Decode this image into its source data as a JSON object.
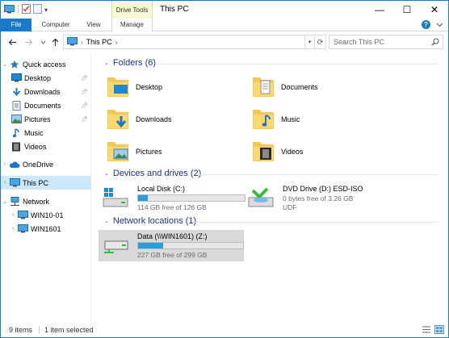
{
  "window": {
    "title": "This PC",
    "context_tab": "Drive Tools",
    "controls": {
      "minimize": "—",
      "maximize": "☐",
      "close": "✕"
    }
  },
  "ribbon": {
    "tabs": [
      "File",
      "Computer",
      "View",
      "Manage"
    ]
  },
  "address": {
    "path": [
      "This PC"
    ],
    "search_placeholder": "Search This PC"
  },
  "nav": {
    "quick_access": "Quick access",
    "quick_items": [
      "Desktop",
      "Downloads",
      "Documents",
      "Pictures",
      "Music",
      "Videos"
    ],
    "pinned": [
      true,
      true,
      true,
      true,
      false,
      false
    ],
    "onedrive": "OneDrive",
    "this_pc": "This PC",
    "network": "Network",
    "network_items": [
      "WIN10-01",
      "WIN1601"
    ]
  },
  "groups": {
    "folders": "Folders (6)",
    "devices": "Devices and drives (2)",
    "network": "Network locations (1)"
  },
  "folders": [
    "Desktop",
    "Documents",
    "Downloads",
    "Music",
    "Pictures",
    "Videos"
  ],
  "drives": [
    {
      "name": "Local Disk (C:)",
      "free": "114 GB free of 126 GB",
      "used_fraction": 0.09
    },
    {
      "name": "DVD Drive (D:) ESD-ISO",
      "free": "0 bytes free of 3.26 GB",
      "fs": "UDF"
    }
  ],
  "network_locations": [
    {
      "name": "Data (\\\\WIN1601) (Z:)",
      "free": "227 GB free of 299 GB",
      "used_fraction": 0.24
    }
  ],
  "status": {
    "items": "9 items",
    "selected": "1 item selected"
  },
  "colors": {
    "accent": "#1979ca",
    "selection": "#cce8ff",
    "bar_fill": "#26a0da",
    "group_header": "#1e3287",
    "context_tab": "#f6f9d3"
  }
}
